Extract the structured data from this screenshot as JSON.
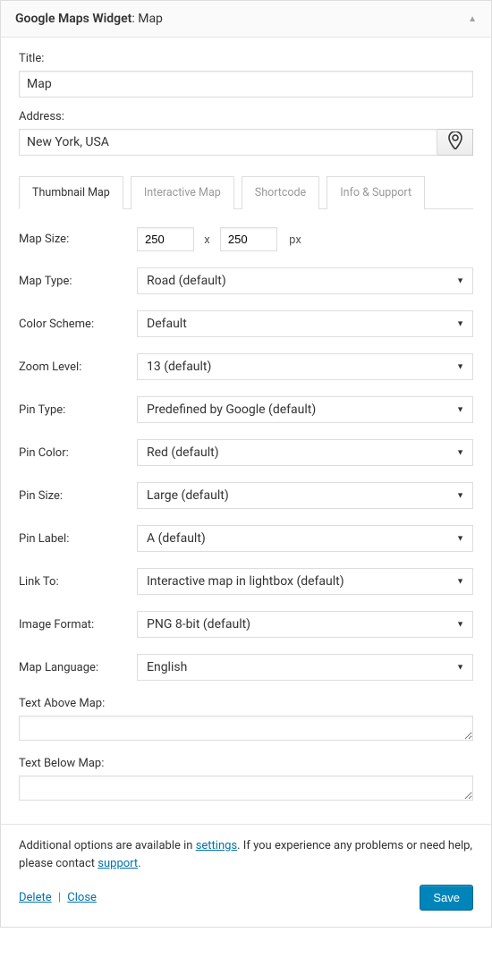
{
  "header": {
    "widget_name": "Google Maps Widget",
    "widget_instance": "Map"
  },
  "fields": {
    "title_label": "Title:",
    "title_value": "Map",
    "address_label": "Address:",
    "address_value": "New York, USA"
  },
  "tabs": {
    "thumbnail": "Thumbnail Map",
    "interactive": "Interactive Map",
    "shortcode": "Shortcode",
    "info": "Info & Support"
  },
  "form": {
    "map_size_label": "Map Size:",
    "map_size_w": "250",
    "map_size_sep": "x",
    "map_size_h": "250",
    "map_size_unit": "px",
    "map_type_label": "Map Type:",
    "map_type_value": "Road (default)",
    "color_scheme_label": "Color Scheme:",
    "color_scheme_value": "Default",
    "zoom_label": "Zoom Level:",
    "zoom_value": "13 (default)",
    "pin_type_label": "Pin Type:",
    "pin_type_value": "Predefined by Google (default)",
    "pin_color_label": "Pin Color:",
    "pin_color_value": "Red (default)",
    "pin_size_label": "Pin Size:",
    "pin_size_value": "Large (default)",
    "pin_label_label": "Pin Label:",
    "pin_label_value": "A (default)",
    "link_to_label": "Link To:",
    "link_to_value": "Interactive map in lightbox (default)",
    "img_format_label": "Image Format:",
    "img_format_value": "PNG 8-bit (default)",
    "lang_label": "Map Language:",
    "lang_value": "English",
    "text_above_label": "Text Above Map:",
    "text_above_value": "",
    "text_below_label": "Text Below Map:",
    "text_below_value": ""
  },
  "footer": {
    "text_prefix": "Additional options are available in ",
    "settings_link": "settings",
    "text_middle": ". If you experience any problems or need help, please contact ",
    "support_link": "support",
    "text_suffix": ".",
    "delete": "Delete",
    "sep": "|",
    "close": "Close",
    "save": "Save"
  }
}
